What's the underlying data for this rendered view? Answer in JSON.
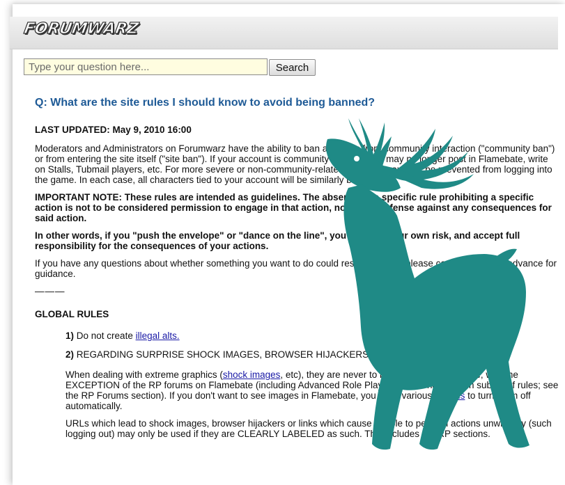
{
  "site": {
    "logo_text": "FORUMWARZ"
  },
  "search": {
    "placeholder": "Type your question here...",
    "button_label": "Search"
  },
  "article": {
    "question": "Q: What are the site rules I should know to avoid being banned?",
    "last_updated": "LAST UPDATED: May 9, 2010 16:00",
    "para1": "Moderators and Administrators on Forumwarz have the ability to ban accounts from community interaction (\"community ban\") or from entering the site itself (\"site ban\"). If your account is community banned, you may no longer post in Flamebate, write on Stalls, Tubmail players, etc. For more severe or non-community-related offenses, you may be prevented from logging into the game. In each case, all characters tied to your account will be similarly banned.",
    "important_note": "IMPORTANT NOTE: These rules are intended as guidelines. The absence of a specific rule prohibiting a specific action is not to be considered permission to engage in that action, nor is it a defense against any consequences for said action.",
    "other_words": "In other words, if you \"push the envelope\" or \"dance on the line\", you do so at your own risk, and accept full responsibility for the consequences of your actions.",
    "questions_para": "If you have any questions about whether something you want to do could result in a ban, please contact a mod in advance for guidance.",
    "separator": "———",
    "global_rules_heading": "GLOBAL RULES",
    "rule1_num": "1)",
    "rule1_text": "Do not create",
    "rule1_link": "illegal alts.",
    "rule2_num": "2)",
    "rule2_text": "REGARDING SURPRISE SHOCK IMAGES, BROWSER HIJACKERS AND UNDESIRED ACTIONS",
    "rule2_para_a": "When dealing with extreme graphics (",
    "rule2_link_shock": "shock images",
    "rule2_para_b": ", etc), they are never to be embedded anywhere, with the EXCEPTION of the RP forums on Flamebate (including Advanced Role Playing, which has its own subset of rules; see the RP Forums section). If you don't want to see images in Flamebate, you have various",
    "rule2_link_options": "options",
    "rule2_para_c": "to turn them off automatically.",
    "urls_para": "URLs which lead to shock images, browser hijackers or links which cause people to perform actions unwillingly (such logging out) may only be used if they are CLEARLY LABELED as such. This includes the RP sections."
  },
  "overlay": {
    "name": "deer-silhouette",
    "color": "#1f8a86"
  }
}
